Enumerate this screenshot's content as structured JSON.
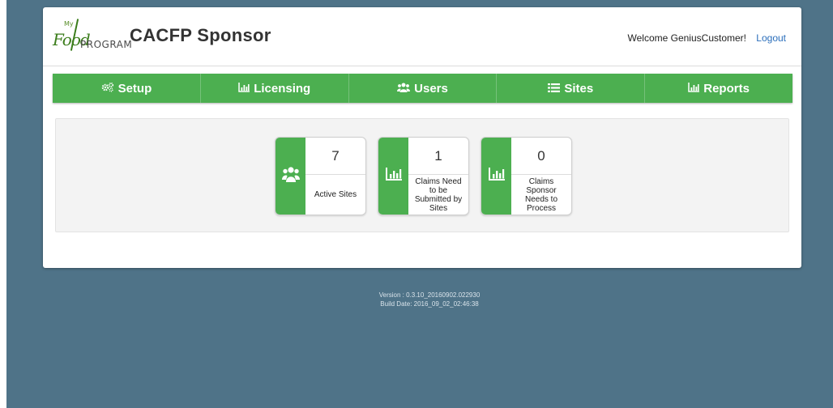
{
  "header": {
    "logo": {
      "my": "My",
      "food": "Food",
      "program": "PROGRAM"
    },
    "title": "CACFP Sponsor",
    "welcome": "Welcome GeniusCustomer!",
    "logout": "Logout"
  },
  "nav": {
    "items": [
      {
        "label": "Setup",
        "icon": "gears-icon"
      },
      {
        "label": "Licensing",
        "icon": "bar-chart-icon"
      },
      {
        "label": "Users",
        "icon": "users-icon"
      },
      {
        "label": "Sites",
        "icon": "list-icon"
      },
      {
        "label": "Reports",
        "icon": "bar-chart-icon"
      }
    ]
  },
  "tiles": [
    {
      "count": "7",
      "label": "Active Sites",
      "icon": "users-icon"
    },
    {
      "count": "1",
      "label": "Claims Need to be Submitted by Sites",
      "icon": "bar-chart-icon"
    },
    {
      "count": "0",
      "label": "Claims Sponsor Needs to Process",
      "icon": "bar-chart-icon"
    }
  ],
  "footer": {
    "version": "Version : 0.3.10_20160902.022930",
    "build_date": "Build Date: 2016_09_02_02:46:38"
  },
  "colors": {
    "background": "#4f7388",
    "accent": "#4caf50",
    "link": "#2a6ebb"
  }
}
